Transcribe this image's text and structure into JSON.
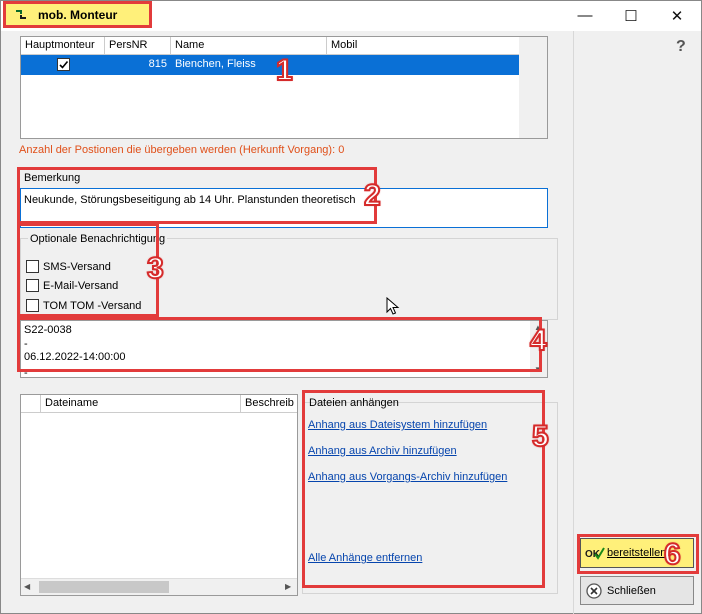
{
  "window": {
    "title": "mob. Monteur",
    "minimize_glyph": "—",
    "maximize_glyph": "☐",
    "close_glyph": "✕"
  },
  "help_glyph": "?",
  "monteur_table": {
    "headers": [
      "Hauptmonteur",
      "PersNR",
      "Name",
      "Mobil"
    ],
    "rows": [
      {
        "haupt": true,
        "persnr": "815",
        "name": "Bienchen, Fleiss",
        "mobil": ""
      }
    ]
  },
  "positions_info": "Anzahl der Postionen die übergeben werden (Herkunft Vorgang): 0",
  "bemerkung": {
    "label": "Bemerkung",
    "value": "Neukunde, Störungsbeseitigung ab 14 Uhr. Planstunden theoretisch"
  },
  "benachrichtigung": {
    "label": "Optionale Benachrichtigung",
    "options": [
      {
        "label": "SMS-Versand",
        "checked": false
      },
      {
        "label": "E-Mail-Versand",
        "checked": false
      },
      {
        "label": "TOM TOM -Versand",
        "checked": false
      }
    ]
  },
  "message_text": {
    "line1": "S22-0038",
    "line2": "-",
    "line3": "06.12.2022-14:00:00",
    "line4": "-"
  },
  "files_table": {
    "headers": [
      "Dateiname",
      "Beschreib"
    ]
  },
  "attachments": {
    "label": "Dateien anhängen",
    "links": [
      "Anhang aus Dateisystem hinzufügen",
      "Anhang aus Archiv hinzufügen",
      "Anhang aus Vorgangs-Archiv hinzufügen"
    ],
    "remove_all": "Alle Anhänge entfernen"
  },
  "buttons": {
    "bereitstellen": "bereitstellen",
    "schliessen": "Schließen"
  },
  "markers": [
    "1",
    "2",
    "3",
    "4",
    "5",
    "6"
  ],
  "colors": {
    "accent_red": "#e23b3b",
    "selection_blue": "#0a70d6",
    "info_orange": "#e0501a",
    "highlight_yellow": "#fff07a",
    "link_blue": "#0645ad"
  }
}
